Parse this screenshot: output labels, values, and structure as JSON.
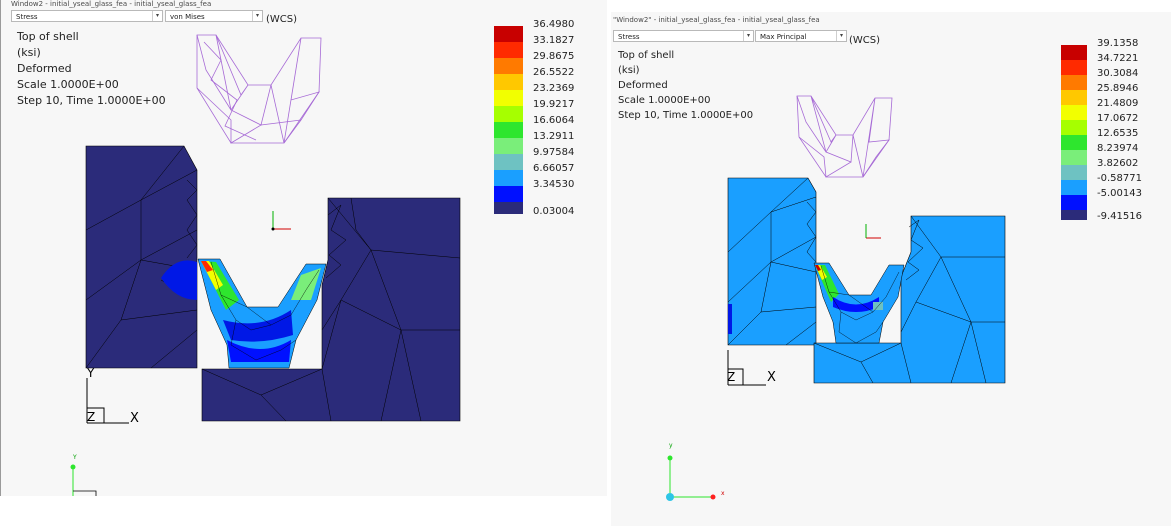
{
  "left": {
    "title": "Window2 - initial_yseal_glass_fea - initial_yseal_glass_fea",
    "result_type": "Stress",
    "component": "von Mises",
    "coord_system": "(WCS)",
    "info": [
      "Top of shell",
      "(ksi)",
      "Deformed",
      "Scale  1.0000E+00",
      "Step 10, Time  1.0000E+00"
    ],
    "legend_labels": [
      "36.4980",
      "33.1827",
      "29.8675",
      "26.5522",
      "23.2369",
      "19.9217",
      "16.6064",
      "13.2911",
      "9.97584",
      "6.66057",
      "3.34530",
      "0.03004"
    ],
    "axis": {
      "x": "X",
      "y": "Y",
      "z": "Z"
    }
  },
  "right": {
    "title": "\"Window2\" - initial_yseal_glass_fea - initial_yseal_glass_fea",
    "result_type": "Stress",
    "component": "Max Principal",
    "coord_system": "(WCS)",
    "info": [
      "Top of shell",
      "(ksi)",
      "Deformed",
      "Scale  1.0000E+00",
      "Step 10, Time  1.0000E+00"
    ],
    "legend_labels": [
      "39.1358",
      "34.7221",
      "30.3084",
      "25.8946",
      "21.4809",
      "17.0672",
      "12.6535",
      "8.23974",
      "3.82602",
      "-0.58771",
      "-5.00143",
      "-9.41516"
    ],
    "axis": {
      "x": "X",
      "z": "Z",
      "tiny_x": "x",
      "tiny_y": "y"
    }
  },
  "colors": {
    "band": [
      "#c80000",
      "#ff2a00",
      "#ff7a00",
      "#ffc800",
      "#f2ff00",
      "#a6ff00",
      "#2ee62e",
      "#7aee7a",
      "#6ec2c2",
      "#1a9fff",
      "#0010ff",
      "#2b2b7a"
    ],
    "mesh_dark": "#2b2b7a",
    "mesh_light": "#1a9fff",
    "outline_purple": "#a76bd6"
  }
}
